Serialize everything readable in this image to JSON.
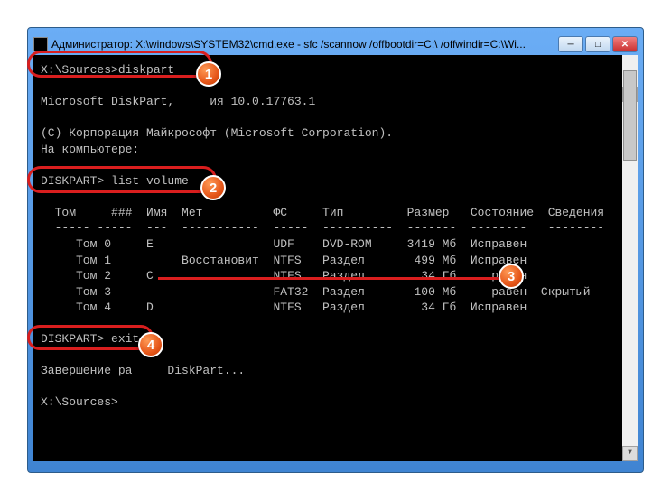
{
  "window": {
    "title": "Администратор: X:\\windows\\SYSTEM32\\cmd.exe - sfc /scannow /offbootdir=C:\\ /offwindir=C:\\Wi..."
  },
  "console": {
    "line1_prompt": "X:\\Sources>",
    "line1_cmd": "diskpart",
    "line2": "Microsoft DiskPart,     ия 10.0.17763.1",
    "line3": "(C) Корпорация Майкрософт (Microsoft Corporation).",
    "line4": "На компьютере:",
    "line5_prompt": "DISKPART> ",
    "line5_cmd": "list volume",
    "header": "  Том     ###  Имя  Мет          ФС     Тип         Размер   Состояние  Сведения",
    "divider": "  ----- -----  ---  -----------  -----  ----------  -------  --------   --------",
    "rows": [
      "     Том 0     E                 UDF    DVD-ROM     3419 Мб  Исправен",
      "     Том 1          Восстановит  NTFS   Раздел       499 Мб  Исправен",
      "     Том 2     C                 NTFS   Раздел        34 Гб     равен",
      "     Том 3                       FAT32  Раздел       100 Мб     равен  Скрытый",
      "     Том 4     D                 NTFS   Раздел        34 Гб  Исправен"
    ],
    "line_exit_prompt": "DISKPART> ",
    "line_exit_cmd": "exit",
    "line_finish": "Завершение ра     DiskPart...",
    "line_last": "X:\\Sources>"
  },
  "chart_data": {
    "type": "table",
    "title": "DISKPART list volume",
    "columns": [
      "Том",
      "###",
      "Имя",
      "Метка",
      "ФС",
      "Тип",
      "Размер",
      "Состояние",
      "Сведения"
    ],
    "rows": [
      {
        "Том": "Том 0",
        "Имя": "E",
        "Метка": "",
        "ФС": "UDF",
        "Тип": "DVD-ROM",
        "Размер": "3419 Мб",
        "Состояние": "Исправен",
        "Сведения": ""
      },
      {
        "Том": "Том 1",
        "Имя": "",
        "Метка": "Восстановит",
        "ФС": "NTFS",
        "Тип": "Раздел",
        "Размер": "499 Мб",
        "Состояние": "Исправен",
        "Сведения": ""
      },
      {
        "Том": "Том 2",
        "Имя": "C",
        "Метка": "",
        "ФС": "NTFS",
        "Тип": "Раздел",
        "Размер": "34 Гб",
        "Состояние": "Исправен",
        "Сведения": ""
      },
      {
        "Том": "Том 3",
        "Имя": "",
        "Метка": "",
        "ФС": "FAT32",
        "Тип": "Раздел",
        "Размер": "100 Мб",
        "Состояние": "Исправен",
        "Сведения": "Скрытый"
      },
      {
        "Том": "Том 4",
        "Имя": "D",
        "Метка": "",
        "ФС": "NTFS",
        "Тип": "Раздел",
        "Размер": "34 Гб",
        "Состояние": "Исправен",
        "Сведения": ""
      }
    ]
  },
  "badges": {
    "b1": "1",
    "b2": "2",
    "b3": "3",
    "b4": "4"
  },
  "glyphs": {
    "min": "─",
    "max": "□",
    "close": "✕",
    "up": "▲",
    "down": "▼"
  }
}
